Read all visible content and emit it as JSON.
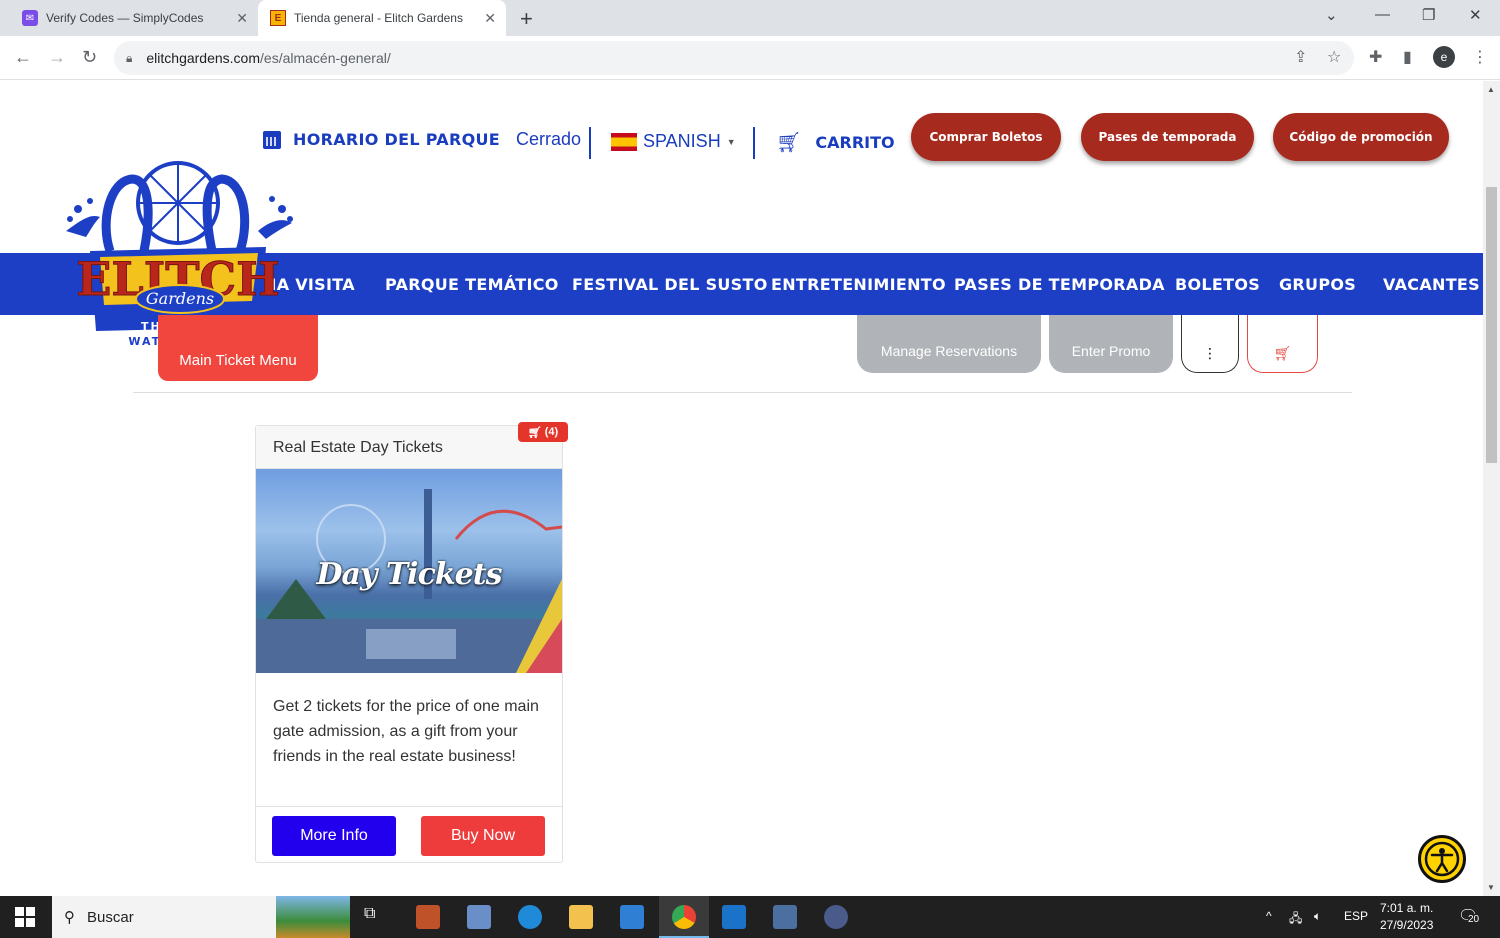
{
  "browser": {
    "tabs": [
      {
        "title": "Verify Codes — SimplyCodes",
        "favicon": "simplycodes-icon",
        "active": false
      },
      {
        "title": "Tienda general - Elitch Gardens",
        "favicon": "elitch-e-icon",
        "active": true
      }
    ],
    "url_host": "elitchgardens.com",
    "url_path": "/es/almacén-general/",
    "profile_initial": "e"
  },
  "header": {
    "hours_label": "HORARIO DEL PARQUE",
    "hours_status": "Cerrado",
    "language": "SPANISH",
    "cart_label": "CARRITO",
    "buttons": [
      "Comprar Boletos",
      "Pases de temporada",
      "Código de promoción"
    ]
  },
  "logo": {
    "brand": "ELITCH",
    "script": "Gardens",
    "tagline_1": "THEME &",
    "tagline_2": "WATER PARK"
  },
  "nav": {
    "items": [
      "NA VISITA",
      "PARQUE TEMÁTICO",
      "FESTIVAL DEL SUSTO",
      "ENTRETENIMIENTO",
      "PASES DE TEMPORADA",
      "BOLETOS",
      "GRUPOS",
      "VACANTES"
    ]
  },
  "subbar": {
    "main_ticket_menu": "Main Ticket Menu",
    "manage_reservations": "Manage Reservations",
    "enter_promo": "Enter Promo"
  },
  "product": {
    "title": "Real Estate Day Tickets",
    "cart_count": "(4)",
    "image_text": "Day Tickets",
    "description": "Get 2 tickets for the price of one main gate admission, as a gift from your friends in the real estate business!",
    "more_info": "More Info",
    "buy_now": "Buy Now"
  },
  "taskbar": {
    "search_placeholder": "Buscar",
    "lang": "ESP",
    "time": "7:01 a. m.",
    "date": "27/9/2023",
    "notifications": "20"
  },
  "colors": {
    "brand_blue": "#1c3fc6",
    "brand_red": "#a72a1f",
    "cta_red": "#ee3b3b",
    "cta_blue": "#2200ee"
  }
}
